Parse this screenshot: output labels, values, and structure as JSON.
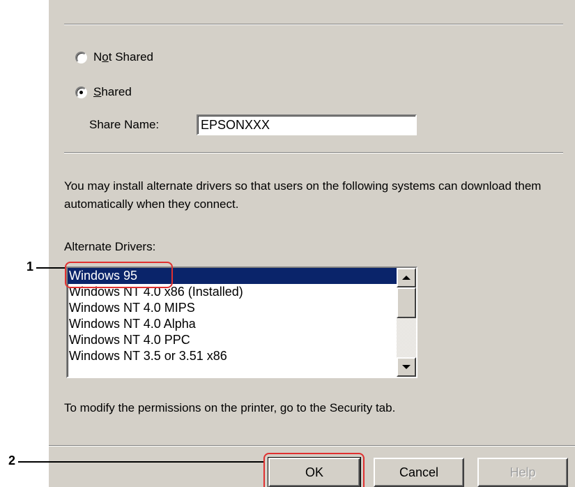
{
  "sharing": {
    "not_shared_prefix": "N",
    "not_shared_mnemonic": "o",
    "not_shared_suffix": "t Shared",
    "shared_mnemonic": "S",
    "shared_suffix": "hared",
    "selected_option": "Shared",
    "share_name_label": "Share Name:",
    "share_name_value": "EPSONXXX"
  },
  "description": "You may install alternate drivers so that users on the following systems can download them automatically when they connect.",
  "alternate_drivers": {
    "label": "Alternate Drivers:",
    "items": [
      {
        "label": "Windows 95",
        "selected": true
      },
      {
        "label": "Windows NT 4.0 x86 (Installed)",
        "selected": false
      },
      {
        "label": "Windows NT 4.0 MIPS",
        "selected": false
      },
      {
        "label": "Windows NT 4.0 Alpha",
        "selected": false
      },
      {
        "label": "Windows NT 4.0 PPC",
        "selected": false
      },
      {
        "label": "Windows NT 3.5 or 3.51 x86",
        "selected": false
      }
    ]
  },
  "permissions_text": "To modify the permissions on the printer, go to the Security tab.",
  "buttons": {
    "ok": "OK",
    "cancel": "Cancel",
    "help": "Help"
  },
  "callouts": {
    "one": "1",
    "two": "2"
  },
  "colors": {
    "dialog_bg": "#d4d0c8",
    "selection": "#0a246a",
    "callout": "#e03030"
  },
  "icons": {
    "scroll_up": "triangle-up",
    "scroll_down": "triangle-down"
  }
}
